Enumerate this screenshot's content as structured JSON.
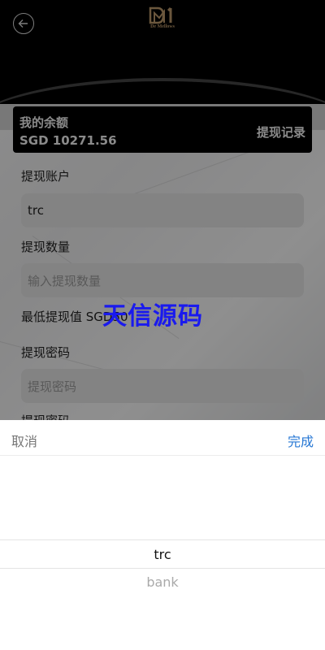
{
  "header": {
    "logo_text": "De Mellows"
  },
  "balance": {
    "label": "我的余额",
    "amount": "SGD 10271.56",
    "history_link": "提现记录"
  },
  "form": {
    "account_label": "提现账户",
    "account_value": "trc",
    "amount_label": "提现数量",
    "amount_placeholder": "输入提现数量",
    "min_label": "最低提现值 SGD50",
    "password_label": "提现密码",
    "password_placeholder": "提现密码",
    "password_label_2": "提现密码"
  },
  "watermark": "天信源码",
  "picker": {
    "cancel": "取消",
    "done": "完成",
    "options": [
      "trc",
      "bank"
    ],
    "selected": "trc"
  },
  "colors": {
    "accent": "#2677d4",
    "logo": "#b8976a",
    "watermark": "#1a1aee"
  }
}
